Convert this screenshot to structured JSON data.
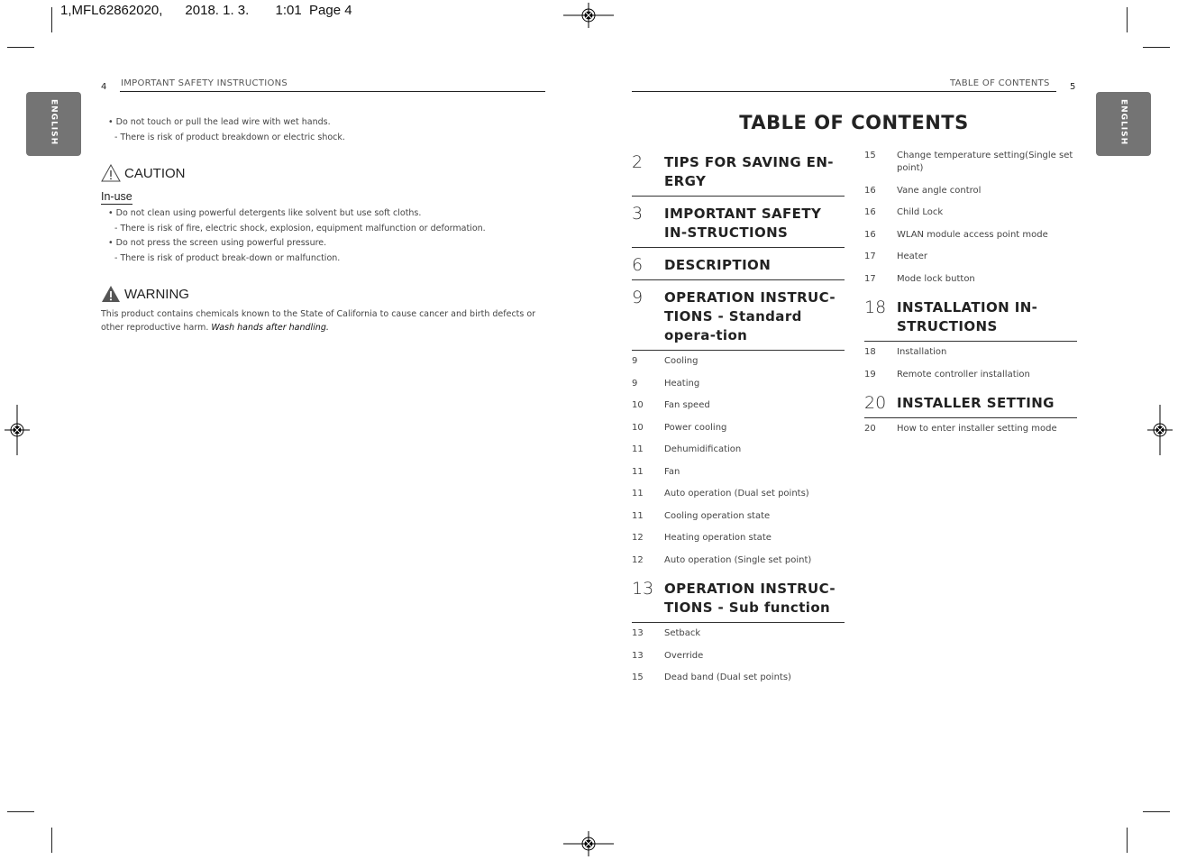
{
  "print_slug": "1,MFL62862020,      2018. 1. 3.       1:01  Page 4",
  "tab_label": "ENGLISH",
  "left_page": {
    "page_number": "4",
    "running_head": "IMPORTANT SAFETY INSTRUCTIONS",
    "intro_bullet": "• Do not touch or pull the lead wire with wet hands.",
    "intro_sub": "- There is risk of product breakdown or electric shock.",
    "caution": {
      "icon": "caution-triangle-outline",
      "title": "CAUTION",
      "subhead": "In-use",
      "lines": [
        "• Do not clean using powerful detergents like solvent but use soft cloths.",
        "- There is risk of fire, electric shock, explosion, equipment malfunction or deformation.",
        "• Do not press the screen using powerful pressure.",
        "- There is risk of product break-down or malfunction."
      ]
    },
    "warning": {
      "icon": "warning-triangle-filled",
      "title": "WARNING",
      "text": "This product contains chemicals known to the State of California to cause cancer and birth defects or other reproductive harm. ",
      "emphasis": "Wash hands after handling."
    }
  },
  "right_page": {
    "page_number": "5",
    "running_head": "TABLE OF CONTENTS",
    "title": "TABLE OF CONTENTS",
    "col1": [
      {
        "type": "h",
        "page": "2",
        "title": "TIPS FOR SAVING EN-ERGY"
      },
      {
        "type": "h",
        "page": "3",
        "title": "IMPORTANT SAFETY IN-STRUCTIONS"
      },
      {
        "type": "h",
        "page": "6",
        "title": "DESCRIPTION"
      },
      {
        "type": "h",
        "page": "9",
        "title": "OPERATION INSTRUC-TIONS - Standard opera-tion"
      },
      {
        "type": "i",
        "page": "9",
        "title": "Cooling"
      },
      {
        "type": "i",
        "page": "9",
        "title": "Heating"
      },
      {
        "type": "i",
        "page": "10",
        "title": "Fan speed"
      },
      {
        "type": "i",
        "page": "10",
        "title": "Power cooling"
      },
      {
        "type": "i",
        "page": "11",
        "title": "Dehumidification"
      },
      {
        "type": "i",
        "page": "11",
        "title": "Fan"
      },
      {
        "type": "i",
        "page": "11",
        "title": "Auto operation (Dual set points)"
      },
      {
        "type": "i",
        "page": "11",
        "title": "Cooling operation state"
      },
      {
        "type": "i",
        "page": "12",
        "title": "Heating operation state"
      },
      {
        "type": "i",
        "page": "12",
        "title": "Auto operation (Single set point)"
      },
      {
        "type": "h",
        "page": "13",
        "title": "OPERATION INSTRUC-TIONS - Sub function"
      },
      {
        "type": "i",
        "page": "13",
        "title": "Setback"
      },
      {
        "type": "i",
        "page": "13",
        "title": "Override"
      },
      {
        "type": "i",
        "page": "15",
        "title": "Dead band (Dual set points)"
      }
    ],
    "col2": [
      {
        "type": "i",
        "page": "15",
        "title": "Change temperature setting(Single set point)"
      },
      {
        "type": "i",
        "page": "16",
        "title": "Vane angle control"
      },
      {
        "type": "i",
        "page": "16",
        "title": "Child Lock"
      },
      {
        "type": "i",
        "page": "16",
        "title": "WLAN module access point mode"
      },
      {
        "type": "i",
        "page": "17",
        "title": "Heater"
      },
      {
        "type": "i",
        "page": "17",
        "title": "Mode lock button"
      },
      {
        "type": "h",
        "page": "18",
        "title": "INSTALLATION IN-STRUCTIONS"
      },
      {
        "type": "i",
        "page": "18",
        "title": "Installation"
      },
      {
        "type": "i",
        "page": "19",
        "title": "Remote controller installation"
      },
      {
        "type": "h",
        "page": "20",
        "title": "INSTALLER SETTING"
      },
      {
        "type": "i",
        "page": "20",
        "title": "How to enter installer setting mode"
      }
    ]
  }
}
